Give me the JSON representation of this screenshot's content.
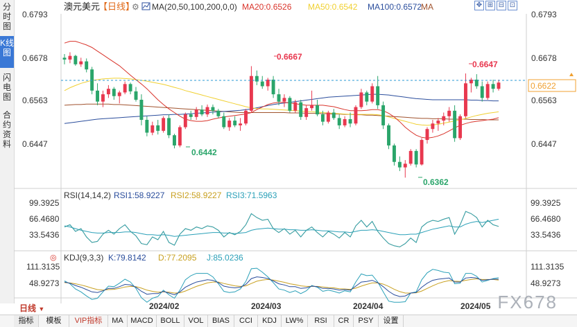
{
  "side_tabs": [
    {
      "label": "分时图",
      "active": false
    },
    {
      "label": "K线图",
      "active": true
    },
    {
      "label": "闪电图",
      "active": false
    },
    {
      "label": "合约资料",
      "active": false
    }
  ],
  "header": {
    "symbol": "澳元美元",
    "period_tag": "【日线】",
    "ma_label": "MA(20,50,100,200,0,0)",
    "ma20": "MA20:0.6526",
    "ma50": "MA50:0.6542",
    "ma100": "MA100:0.6572",
    "ma200": "MA"
  },
  "colors": {
    "up": "#e8384f",
    "down": "#2aa56a",
    "ma20": "#d9342b",
    "ma50": "#f0d030",
    "ma100": "#2a4d9c",
    "ma200": "#a0522d",
    "rsi1": "#2a4d9c",
    "rsi2": "#c8a020",
    "rsi3": "#2aa0b8"
  },
  "price_axis": {
    "ticks": [
      "0.6793",
      "0.6678",
      "0.6563",
      "0.6447"
    ],
    "current": "0.6622"
  },
  "annotations": {
    "high1": "0.6667",
    "high2": "0.6647",
    "low1": "0.6442",
    "low2": "0.6362"
  },
  "rsi": {
    "label": "RSI(14,14,2)",
    "rsi1": "RSI1:58.9227",
    "rsi2": "RSI2:58.9227",
    "rsi3": "RSI3:71.5963",
    "ticks": [
      "99.3925",
      "66.4680",
      "33.5436"
    ]
  },
  "kdj": {
    "label": "KDJ(9,3,3)",
    "k": "K:79.8142",
    "d": "D:77.2095",
    "j": "J:85.0236",
    "ticks": [
      "111.3135",
      "48.9273"
    ]
  },
  "xaxis": {
    "labels": [
      "2024/02",
      "2024/03",
      "2024/04",
      "2024/05"
    ]
  },
  "period_button": "日线",
  "toolbar": [
    "指标",
    "模板",
    "VIP指标",
    "MA",
    "MACD",
    "BOLL",
    "VOL",
    "BIAS",
    "CCI",
    "KDJ",
    "LW%",
    "RSI",
    "CR",
    "PSY",
    "设置"
  ],
  "watermark": "FX678",
  "chart_data": {
    "type": "candlestick",
    "price_ylim": [
      0.634,
      0.681
    ],
    "candles": [
      [
        0.669,
        0.67,
        0.6672,
        0.6685
      ],
      [
        0.6685,
        0.6705,
        0.6675,
        0.6695
      ],
      [
        0.6695,
        0.6698,
        0.6668,
        0.6672
      ],
      [
        0.6672,
        0.669,
        0.6665,
        0.668
      ],
      [
        0.668,
        0.6688,
        0.665,
        0.6658
      ],
      [
        0.6658,
        0.6665,
        0.659,
        0.66
      ],
      [
        0.66,
        0.662,
        0.656,
        0.657
      ],
      [
        0.657,
        0.66,
        0.6555,
        0.659
      ],
      [
        0.659,
        0.6615,
        0.658,
        0.6605
      ],
      [
        0.6605,
        0.661,
        0.6575,
        0.6585
      ],
      [
        0.6585,
        0.66,
        0.6565,
        0.6595
      ],
      [
        0.6595,
        0.6625,
        0.659,
        0.6618
      ],
      [
        0.6618,
        0.6622,
        0.659,
        0.6598
      ],
      [
        0.6598,
        0.661,
        0.657,
        0.6575
      ],
      [
        0.6575,
        0.659,
        0.6505,
        0.652
      ],
      [
        0.652,
        0.653,
        0.6475,
        0.6485
      ],
      [
        0.6485,
        0.6515,
        0.6478,
        0.6505
      ],
      [
        0.6505,
        0.652,
        0.648,
        0.649
      ],
      [
        0.649,
        0.653,
        0.6485,
        0.6525
      ],
      [
        0.6525,
        0.6535,
        0.647,
        0.6478
      ],
      [
        0.6478,
        0.6482,
        0.6442,
        0.645
      ],
      [
        0.645,
        0.6505,
        0.6445,
        0.65
      ],
      [
        0.65,
        0.654,
        0.6495,
        0.6535
      ],
      [
        0.6535,
        0.6545,
        0.652,
        0.6528
      ],
      [
        0.6528,
        0.6555,
        0.652,
        0.6548
      ],
      [
        0.6548,
        0.656,
        0.653,
        0.6535
      ],
      [
        0.6535,
        0.6562,
        0.6528,
        0.6555
      ],
      [
        0.6555,
        0.6562,
        0.6535,
        0.6545
      ],
      [
        0.6545,
        0.655,
        0.6525,
        0.653
      ],
      [
        0.653,
        0.654,
        0.6495,
        0.65
      ],
      [
        0.65,
        0.6525,
        0.649,
        0.6518
      ],
      [
        0.6518,
        0.653,
        0.65,
        0.6505
      ],
      [
        0.6505,
        0.6525,
        0.649,
        0.651
      ],
      [
        0.651,
        0.655,
        0.6505,
        0.6545
      ],
      [
        0.6545,
        0.6667,
        0.654,
        0.664
      ],
      [
        0.664,
        0.6655,
        0.6615,
        0.6625
      ],
      [
        0.6625,
        0.664,
        0.6605,
        0.6612
      ],
      [
        0.6612,
        0.6635,
        0.66,
        0.663
      ],
      [
        0.663,
        0.664,
        0.658,
        0.659
      ],
      [
        0.659,
        0.6605,
        0.656,
        0.657
      ],
      [
        0.657,
        0.659,
        0.6555,
        0.658
      ],
      [
        0.658,
        0.6585,
        0.654,
        0.6545
      ],
      [
        0.6545,
        0.6575,
        0.654,
        0.6568
      ],
      [
        0.6568,
        0.6575,
        0.652,
        0.6528
      ],
      [
        0.6528,
        0.656,
        0.652,
        0.6552
      ],
      [
        0.6552,
        0.66,
        0.6545,
        0.656
      ],
      [
        0.656,
        0.6575,
        0.653,
        0.6535
      ],
      [
        0.6535,
        0.6545,
        0.6505,
        0.6515
      ],
      [
        0.6515,
        0.6545,
        0.651,
        0.654
      ],
      [
        0.654,
        0.655,
        0.652,
        0.6525
      ],
      [
        0.6525,
        0.6535,
        0.6495,
        0.6505
      ],
      [
        0.6505,
        0.653,
        0.65,
        0.6522
      ],
      [
        0.6522,
        0.654,
        0.65,
        0.651
      ],
      [
        0.651,
        0.656,
        0.6505,
        0.6555
      ],
      [
        0.6555,
        0.6605,
        0.655,
        0.6595
      ],
      [
        0.6595,
        0.66,
        0.656,
        0.657
      ],
      [
        0.657,
        0.662,
        0.6565,
        0.6612
      ],
      [
        0.6612,
        0.664,
        0.655,
        0.656
      ],
      [
        0.656,
        0.657,
        0.6495,
        0.6505
      ],
      [
        0.6505,
        0.651,
        0.644,
        0.645
      ],
      [
        0.645,
        0.6455,
        0.6395,
        0.6405
      ],
      [
        0.6405,
        0.642,
        0.638,
        0.639
      ],
      [
        0.639,
        0.641,
        0.6362,
        0.64
      ],
      [
        0.64,
        0.644,
        0.6395,
        0.6435
      ],
      [
        0.6435,
        0.644,
        0.639,
        0.6398
      ],
      [
        0.6398,
        0.647,
        0.6395,
        0.6465
      ],
      [
        0.6465,
        0.65,
        0.6455,
        0.6495
      ],
      [
        0.6495,
        0.652,
        0.6485,
        0.651
      ],
      [
        0.651,
        0.6525,
        0.649,
        0.6518
      ],
      [
        0.6518,
        0.654,
        0.6505,
        0.653
      ],
      [
        0.653,
        0.6555,
        0.6515,
        0.6545
      ],
      [
        0.6545,
        0.656,
        0.646,
        0.647
      ],
      [
        0.647,
        0.6535,
        0.6465,
        0.653
      ],
      [
        0.653,
        0.6647,
        0.6525,
        0.662
      ],
      [
        0.662,
        0.6635,
        0.6595,
        0.663
      ],
      [
        0.663,
        0.6645,
        0.6605,
        0.6612
      ],
      [
        0.6612,
        0.6625,
        0.657,
        0.658
      ],
      [
        0.658,
        0.6625,
        0.6575,
        0.6618
      ],
      [
        0.6618,
        0.663,
        0.6595,
        0.6605
      ],
      [
        0.6605,
        0.663,
        0.66,
        0.6622
      ]
    ],
    "ma20": [
      0.673,
      0.6735,
      0.6735,
      0.673,
      0.6725,
      0.6718,
      0.6708,
      0.6698,
      0.6688,
      0.6678,
      0.6668,
      0.6655,
      0.6642,
      0.663,
      0.6618,
      0.6605,
      0.659,
      0.6575,
      0.6562,
      0.655,
      0.654,
      0.653,
      0.6522,
      0.6518,
      0.6516,
      0.6516,
      0.6518,
      0.6522,
      0.6525,
      0.6528,
      0.653,
      0.6532,
      0.6534,
      0.6536,
      0.654,
      0.6548,
      0.6555,
      0.6562,
      0.6566,
      0.6568,
      0.6568,
      0.6566,
      0.6564,
      0.6562,
      0.656,
      0.656,
      0.656,
      0.656,
      0.6558,
      0.6556,
      0.6552,
      0.6548,
      0.6545,
      0.6545,
      0.6545,
      0.6546,
      0.6548,
      0.6548,
      0.6545,
      0.6538,
      0.6528,
      0.6515,
      0.65,
      0.6488,
      0.6478,
      0.6472,
      0.647,
      0.6472,
      0.6476,
      0.6482,
      0.649,
      0.6498,
      0.6505,
      0.651,
      0.6514,
      0.6516,
      0.6518,
      0.652,
      0.6522,
      0.6526
    ],
    "ma50": [
      0.66,
      0.6608,
      0.6614,
      0.662,
      0.6624,
      0.6628,
      0.663,
      0.6632,
      0.6633,
      0.6634,
      0.6634,
      0.6633,
      0.6632,
      0.663,
      0.6628,
      0.6626,
      0.6623,
      0.662,
      0.6617,
      0.6613,
      0.6609,
      0.6605,
      0.66,
      0.6596,
      0.6592,
      0.6588,
      0.6584,
      0.658,
      0.6576,
      0.6572,
      0.6568,
      0.6564,
      0.656,
      0.6556,
      0.6553,
      0.6551,
      0.655,
      0.655,
      0.6549,
      0.6548,
      0.6547,
      0.6546,
      0.6545,
      0.6544,
      0.6543,
      0.6542,
      0.6541,
      0.654,
      0.6539,
      0.6538,
      0.6537,
      0.6536,
      0.6535,
      0.6535,
      0.6535,
      0.6535,
      0.6535,
      0.6534,
      0.6532,
      0.6528,
      0.6524,
      0.652,
      0.6516,
      0.6512,
      0.6508,
      0.6506,
      0.6505,
      0.6506,
      0.6508,
      0.6511,
      0.6514,
      0.6517,
      0.652,
      0.6524,
      0.6528,
      0.6532,
      0.6535,
      0.6538,
      0.654,
      0.6542
    ],
    "ma100": [
      0.651,
      0.6512,
      0.6514,
      0.6516,
      0.6518,
      0.652,
      0.6522,
      0.6523,
      0.6524,
      0.6525,
      0.6526,
      0.6527,
      0.6528,
      0.6529,
      0.653,
      0.6531,
      0.6532,
      0.6533,
      0.6534,
      0.6534,
      0.6535,
      0.6535,
      0.6536,
      0.6537,
      0.6538,
      0.6539,
      0.654,
      0.6541,
      0.6542,
      0.6543,
      0.6544,
      0.6545,
      0.6546,
      0.6548,
      0.655,
      0.6553,
      0.6556,
      0.6559,
      0.6562,
      0.6564,
      0.6566,
      0.6568,
      0.657,
      0.6572,
      0.6574,
      0.6576,
      0.6578,
      0.658,
      0.6582,
      0.6583,
      0.6584,
      0.6585,
      0.6586,
      0.6587,
      0.6588,
      0.6589,
      0.659,
      0.659,
      0.6589,
      0.6588,
      0.6586,
      0.6584,
      0.6582,
      0.658,
      0.6578,
      0.6577,
      0.6576,
      0.6575,
      0.6575,
      0.6575,
      0.6575,
      0.6575,
      0.6575,
      0.6575,
      0.6574,
      0.6574,
      0.6573,
      0.6573,
      0.6572,
      0.6572
    ],
    "ma200": [
      0.656,
      0.6561,
      0.6562,
      0.6562,
      0.6563,
      0.6563,
      0.6563,
      0.6563,
      0.6563,
      0.6562,
      0.6562,
      0.6561,
      0.656,
      0.6559,
      0.6558,
      0.6557,
      0.6556,
      0.6555,
      0.6554,
      0.6553,
      0.6552,
      0.6551,
      0.655,
      0.6549,
      0.6548,
      0.6547,
      0.6546,
      0.6545,
      0.6544,
      0.6543,
      0.6542,
      0.6541,
      0.654,
      0.654,
      0.654,
      0.654,
      0.654,
      0.654,
      0.654,
      0.654,
      0.654,
      0.6539,
      0.6539,
      0.6539,
      0.6538,
      0.6538,
      0.6538,
      0.6537,
      0.6537,
      0.6536,
      0.6536,
      0.6535,
      0.6535,
      0.6534,
      0.6534,
      0.6533,
      0.6533,
      0.6532,
      0.6531,
      0.653,
      0.6529,
      0.6528,
      0.6527,
      0.6526,
      0.6525,
      0.6524,
      0.6524,
      0.6523,
      0.6523,
      0.6523,
      0.6522,
      0.6522,
      0.6522,
      0.6522,
      0.6521,
      0.6521,
      0.6521,
      0.652,
      0.652,
      0.652
    ],
    "rsi_ylim": [
      20,
      105
    ],
    "rsi1": [
      58,
      62,
      50,
      55,
      40,
      30,
      32,
      45,
      52,
      45,
      55,
      62,
      50,
      42,
      28,
      26,
      40,
      35,
      50,
      30,
      25,
      45,
      55,
      52,
      58,
      55,
      60,
      58,
      52,
      40,
      48,
      44,
      50,
      62,
      82,
      75,
      70,
      72,
      55,
      48,
      55,
      45,
      52,
      40,
      52,
      58,
      48,
      40,
      50,
      45,
      38,
      48,
      40,
      60,
      70,
      58,
      68,
      50,
      38,
      28,
      24,
      22,
      28,
      38,
      30,
      58,
      66,
      70,
      68,
      72,
      75,
      45,
      62,
      86,
      82,
      75,
      58,
      70,
      62,
      59
    ],
    "rsi2": [
      58,
      62,
      50,
      55,
      40,
      30,
      32,
      45,
      52,
      45,
      55,
      62,
      50,
      42,
      28,
      26,
      40,
      35,
      50,
      30,
      25,
      45,
      55,
      52,
      58,
      55,
      60,
      58,
      52,
      40,
      48,
      44,
      50,
      62,
      82,
      75,
      70,
      72,
      55,
      48,
      55,
      45,
      52,
      40,
      52,
      58,
      48,
      40,
      50,
      45,
      38,
      48,
      40,
      60,
      70,
      58,
      68,
      50,
      38,
      28,
      24,
      22,
      28,
      38,
      30,
      58,
      66,
      70,
      68,
      72,
      75,
      45,
      62,
      86,
      82,
      75,
      58,
      70,
      62,
      59
    ],
    "rsi3": [
      60,
      58,
      55,
      52,
      50,
      48,
      47,
      47,
      48,
      48,
      48,
      49,
      49,
      48,
      46,
      44,
      44,
      43,
      44,
      43,
      41,
      42,
      43,
      44,
      45,
      46,
      47,
      48,
      48,
      47,
      47,
      46,
      47,
      48,
      52,
      54,
      55,
      56,
      55,
      54,
      54,
      53,
      53,
      52,
      52,
      53,
      52,
      51,
      51,
      50,
      49,
      49,
      48,
      50,
      52,
      52,
      53,
      52,
      50,
      48,
      46,
      44,
      44,
      45,
      45,
      48,
      51,
      54,
      56,
      58,
      60,
      58,
      58,
      63,
      66,
      68,
      66,
      68,
      70,
      72
    ],
    "kdj_ylim": [
      20,
      135
    ],
    "k": [
      70,
      66,
      58,
      52,
      44,
      36,
      34,
      40,
      48,
      48,
      54,
      62,
      60,
      52,
      38,
      28,
      30,
      30,
      38,
      32,
      26,
      36,
      52,
      62,
      70,
      74,
      78,
      76,
      68,
      56,
      52,
      50,
      52,
      62,
      82,
      88,
      86,
      82,
      74,
      64,
      60,
      54,
      54,
      48,
      50,
      56,
      54,
      48,
      48,
      46,
      42,
      44,
      42,
      56,
      70,
      72,
      76,
      68,
      54,
      38,
      26,
      20,
      22,
      32,
      34,
      52,
      66,
      76,
      80,
      82,
      84,
      70,
      70,
      84,
      86,
      84,
      76,
      78,
      80,
      80
    ],
    "d": [
      68,
      67,
      64,
      60,
      55,
      49,
      44,
      42,
      44,
      45,
      48,
      53,
      55,
      54,
      49,
      42,
      38,
      35,
      36,
      35,
      32,
      33,
      39,
      47,
      55,
      61,
      67,
      70,
      70,
      65,
      61,
      57,
      55,
      57,
      65,
      73,
      77,
      79,
      77,
      73,
      69,
      64,
      61,
      57,
      55,
      55,
      55,
      53,
      51,
      50,
      47,
      46,
      45,
      49,
      56,
      62,
      67,
      67,
      63,
      55,
      45,
      37,
      32,
      32,
      33,
      39,
      48,
      57,
      65,
      71,
      75,
      73,
      72,
      76,
      79,
      81,
      79,
      79,
      79,
      77
    ],
    "j": [
      74,
      64,
      46,
      36,
      22,
      10,
      14,
      36,
      56,
      54,
      66,
      80,
      70,
      48,
      16,
      0,
      14,
      20,
      42,
      26,
      14,
      42,
      78,
      92,
      100,
      100,
      100,
      88,
      64,
      38,
      34,
      36,
      46,
      72,
      116,
      118,
      104,
      88,
      68,
      46,
      42,
      34,
      40,
      30,
      40,
      58,
      52,
      38,
      42,
      38,
      32,
      40,
      36,
      70,
      98,
      92,
      94,
      70,
      36,
      4,
      0,
      0,
      2,
      32,
      36,
      78,
      102,
      114,
      110,
      104,
      102,
      64,
      66,
      100,
      100,
      90,
      70,
      76,
      82,
      85
    ]
  }
}
